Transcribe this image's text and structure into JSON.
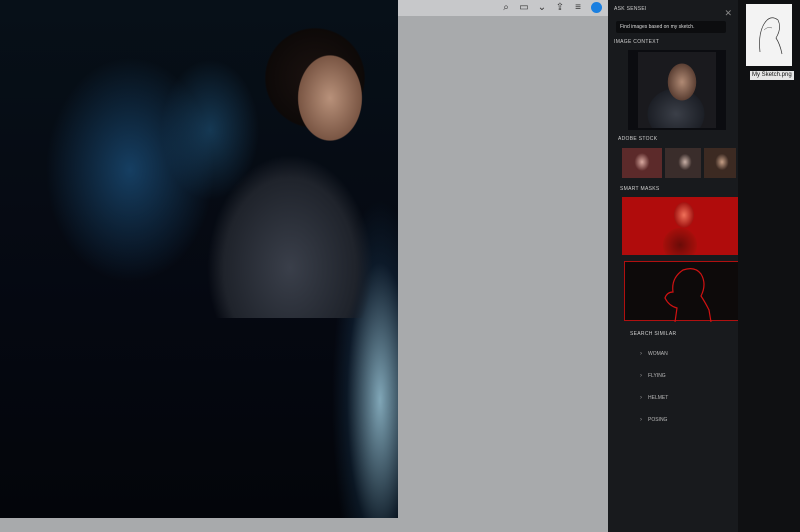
{
  "toolbar": {
    "icons": [
      "search-icon",
      "panel-toggle-icon",
      "chevron-down-icon",
      "share-icon",
      "menu-icon",
      "active-indicator"
    ]
  },
  "panel": {
    "ask_label": "ASK SENSEI",
    "prompt": "Find images based on my sketch.",
    "image_context_label": "IMAGE CONTEXT",
    "adobe_stock_label": "ADOBE STOCK",
    "smart_masks_label": "SMART MASKS",
    "search_similar_label": "SEARCH SIMILAR",
    "similar_items": [
      "WOMAN",
      "FLYING",
      "HELMET",
      "POSING"
    ]
  },
  "sketch_file": {
    "caption": "My Sketch.png"
  },
  "colors": {
    "accent": "#1a7fe0",
    "mask_red": "#b00c0c",
    "panel_bg": "#181a1d"
  }
}
